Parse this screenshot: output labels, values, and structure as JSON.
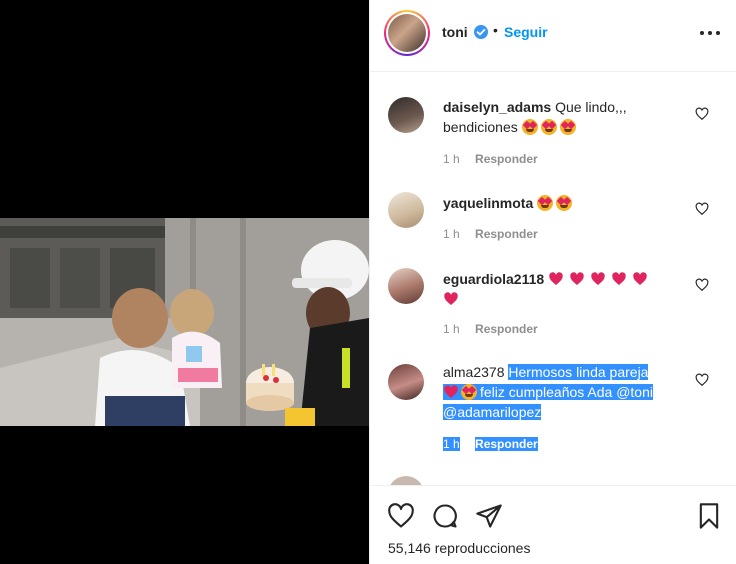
{
  "post": {
    "username": "toni",
    "verified_icon": "verified-badge-icon",
    "separator": "•",
    "follow_label": "Seguir",
    "more_icon": "more-options-icon"
  },
  "comments": [
    {
      "user": "daiselyn_adams",
      "text": "Que lindo,,, bendiciones",
      "emojis": [
        "heart-eyes",
        "heart-eyes",
        "heart-eyes"
      ],
      "time": "1 h",
      "reply": "Responder"
    },
    {
      "user": "yaquelinmota",
      "text": "",
      "emojis": [
        "heart-eyes",
        "heart-eyes"
      ],
      "time": "1 h",
      "reply": "Responder"
    },
    {
      "user": "eguardiola2118",
      "text": "",
      "emojis": [
        "red-heart",
        "red-heart",
        "red-heart",
        "red-heart",
        "red-heart",
        "red-heart"
      ],
      "time": "1 h",
      "reply": "Responder"
    },
    {
      "user": "alma2378",
      "text_before": "Hermosos linda pareja",
      "text_after": "feliz cumpleaños Ada @toni @adamarilopez",
      "emojis": [
        "red-heart",
        "heart-eyes"
      ],
      "time": "1 h",
      "reply": "Responder",
      "selected": true
    }
  ],
  "footer": {
    "like_icon": "heart-icon",
    "comment_icon": "comment-icon",
    "share_icon": "share-icon",
    "save_icon": "bookmark-icon",
    "views_count": "55,146",
    "views_label": "reproducciones"
  },
  "colors": {
    "accent": "#0095f6",
    "verified": "#3897f0",
    "selection": "#3390ff",
    "muted": "#8e8e8e",
    "heart": "#e0245e"
  }
}
